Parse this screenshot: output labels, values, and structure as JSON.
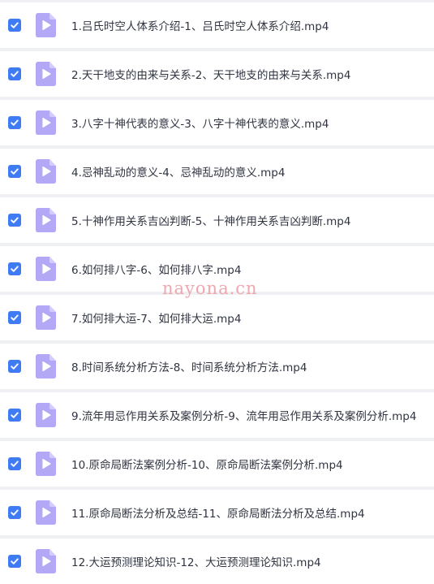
{
  "colors": {
    "checkbox": "#3f7bf2",
    "file_icon": "#b3a8f5",
    "file_icon_fold": "#d4ccfb",
    "row_bg": "#ffffff",
    "separator": "#eef0f3",
    "watermark": "#f0a6ad"
  },
  "icons": {
    "checkbox": "checkmark-icon",
    "file": "video-file-icon"
  },
  "files": [
    {
      "name": "1.吕氏时空人体系介绍-1、吕氏时空人体系介绍.mp4",
      "checked": true
    },
    {
      "name": "2.天干地支的由来与关系-2、天干地支的由来与关系.mp4",
      "checked": true
    },
    {
      "name": "3.八字十神代表的意义-3、八字十神代表的意义.mp4",
      "checked": true
    },
    {
      "name": "4.忌神乱动的意义-4、忌神乱动的意义.mp4",
      "checked": true
    },
    {
      "name": "5.十神作用关系吉凶判断-5、十神作用关系吉凶判断.mp4",
      "checked": true
    },
    {
      "name": "6.如何排八字-6、如何排八字.mp4",
      "checked": true
    },
    {
      "name": "7.如何排大运-7、如何排大运.mp4",
      "checked": true
    },
    {
      "name": "8.时间系统分析方法-8、时间系统分析方法.mp4",
      "checked": true
    },
    {
      "name": "9.流年用忌作用关系及案例分析-9、流年用忌作用关系及案例分析.mp4",
      "checked": true
    },
    {
      "name": "10.原命局断法案例分析-10、原命局断法案例分析.mp4",
      "checked": true
    },
    {
      "name": "11.原命局断法分析及总结-11、原命局断法分析及总结.mp4",
      "checked": true
    },
    {
      "name": "12.大运预测理论知识-12、大运预测理论知识.mp4",
      "checked": true
    }
  ],
  "watermark": "nayona.cn"
}
